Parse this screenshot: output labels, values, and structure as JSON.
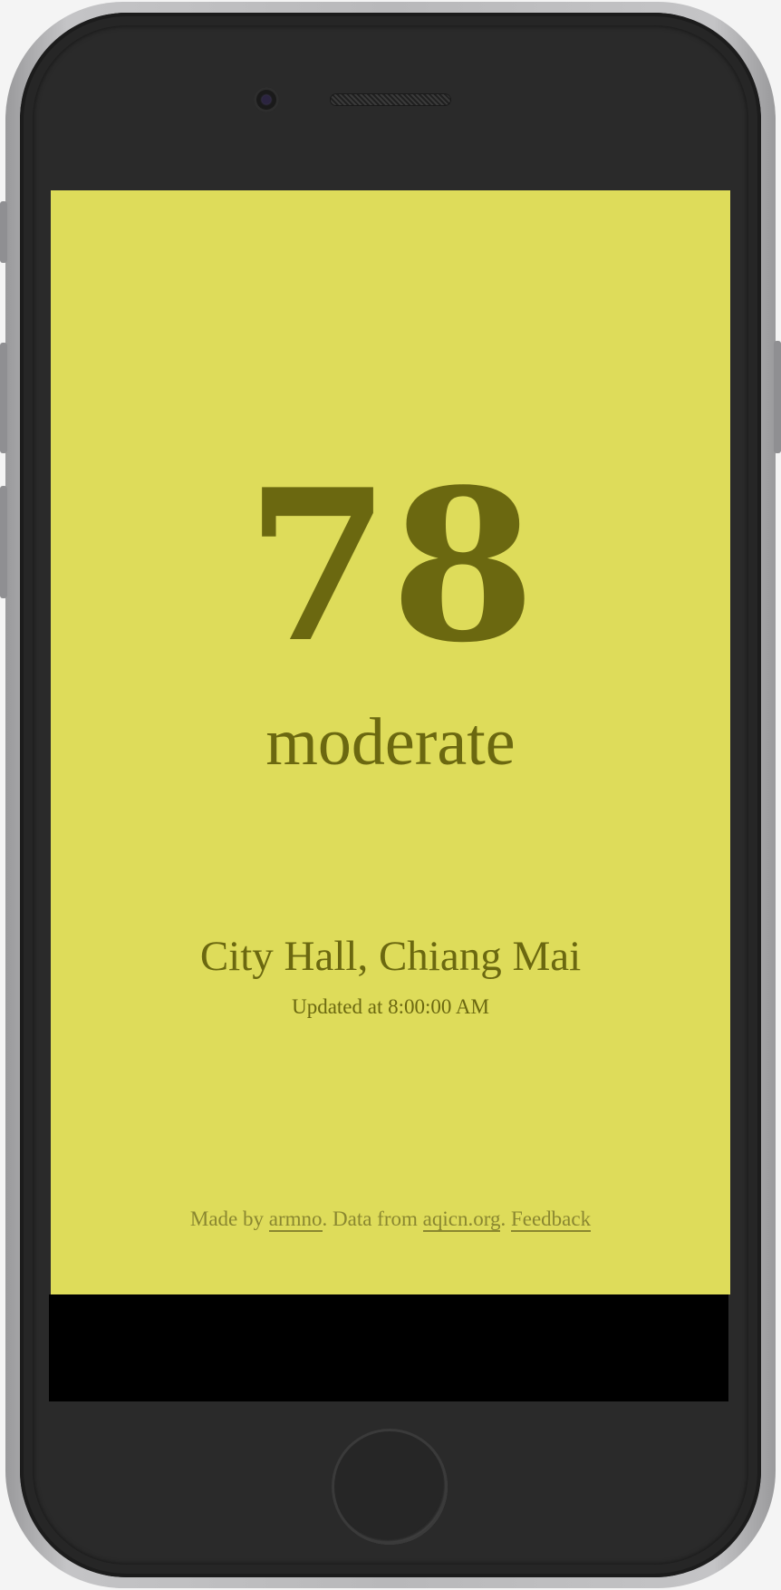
{
  "aqi": {
    "value": "78",
    "level": "moderate"
  },
  "location": {
    "station": "City Hall, Chiang Mai",
    "updated": "Updated at 8:00:00 AM"
  },
  "footer": {
    "made_by_prefix": "Made by ",
    "author_link": "armno",
    "data_prefix": ". Data from ",
    "source_link": "aqicn.org",
    "separator": ". ",
    "feedback_link": "Feedback"
  },
  "colors": {
    "background": "#dedc5a",
    "text": "#6b6810",
    "footer_text": "#8a8730"
  }
}
